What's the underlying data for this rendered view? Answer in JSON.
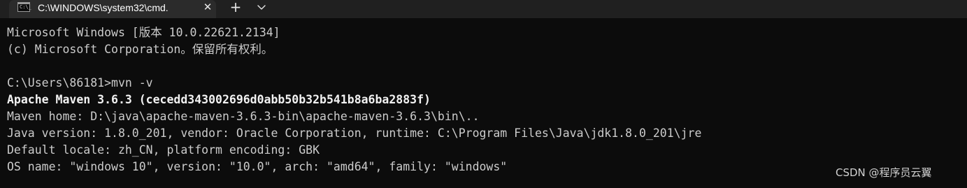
{
  "tab": {
    "icon": "cmd-icon",
    "title": "C:\\WINDOWS\\system32\\cmd.",
    "close_glyph": "✕"
  },
  "toolbar": {
    "new_tab_glyph": "+",
    "dropdown_icon": "chevron-down-icon"
  },
  "terminal": {
    "lines": [
      "Microsoft Windows [版本 10.0.22621.2134]",
      "(c) Microsoft Corporation。保留所有权利。",
      "",
      "C:\\Users\\86181>mvn -v",
      "Apache Maven 3.6.3 (cecedd343002696d0abb50b32b541b8a6ba2883f)",
      "Maven home: D:\\java\\apache-maven-3.6.3-bin\\apache-maven-3.6.3\\bin\\..",
      "Java version: 1.8.0_201, vendor: Oracle Corporation, runtime: C:\\Program Files\\Java\\jdk1.8.0_201\\jre",
      "Default locale: zh_CN, platform encoding: GBK",
      "OS name: \"windows 10\", version: \"10.0\", arch: \"amd64\", family: \"windows\""
    ]
  },
  "watermark": "CSDN @程序员云翼",
  "colors": {
    "terminal_bg": "#0c0c0c",
    "tabbar_bg": "#202020",
    "active_tab_bg": "#2b2b2b",
    "text": "#cccccc",
    "bold_text": "#f2f2f2"
  }
}
